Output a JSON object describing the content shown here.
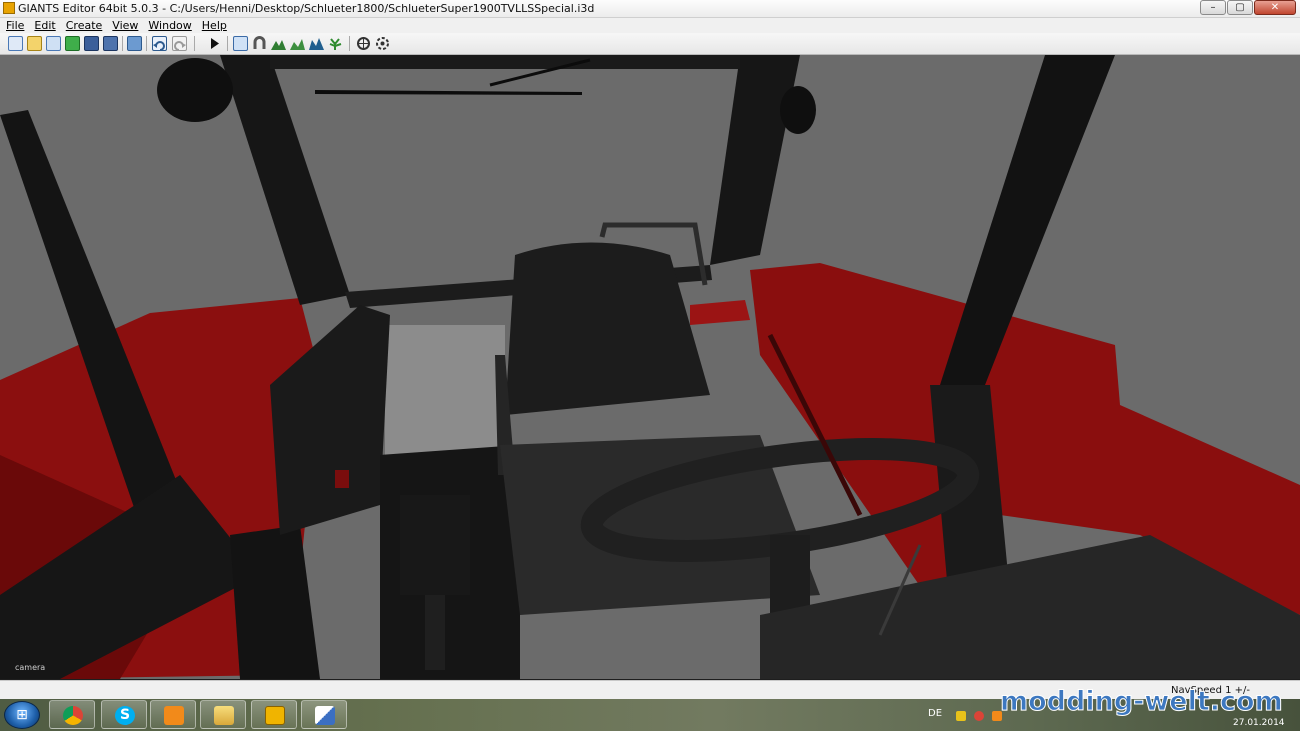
{
  "window": {
    "title": "GIANTS Editor 64bit 5.0.3 - C:/Users/Henni/Desktop/Schlueter1800/SchlueterSuper1900TVLLSSpecial.i3d",
    "buttons": {
      "minimize": "–",
      "maximize": "▢",
      "close": "✕"
    }
  },
  "menu": [
    {
      "label": "File"
    },
    {
      "label": "Edit"
    },
    {
      "label": "Create"
    },
    {
      "label": "View"
    },
    {
      "label": "Window"
    },
    {
      "label": "Help"
    }
  ],
  "toolbar": {
    "icons": [
      "new-file-icon",
      "open-file-icon",
      "open-recent-icon",
      "reload-icon",
      "save-icon",
      "save-as-icon",
      "import-icon",
      "undo-icon",
      "redo-icon",
      "play-icon",
      "select-icon",
      "magnet-icon",
      "terrain-icon",
      "terrain-paint-icon",
      "terrain-height-icon",
      "foliage-icon",
      "move-icon",
      "rotate-icon"
    ]
  },
  "viewport": {
    "camera_label": "camera"
  },
  "statusbar": {
    "nav_speed": "NavSpeed 1 +/-"
  },
  "taskbar": {
    "start": "start-button",
    "apps": [
      "chrome",
      "skype",
      "media-player",
      "file-explorer",
      "giants-editor",
      "paint"
    ],
    "language": "DE",
    "date": "27.01.2014"
  },
  "watermark": "modding-welt.com",
  "colors": {
    "sky": "#6b6b6b",
    "cab_red": "#8b0f0f",
    "frame_black": "#141414",
    "taskbar": "#5d6950",
    "watermark": "#3d78c0"
  }
}
